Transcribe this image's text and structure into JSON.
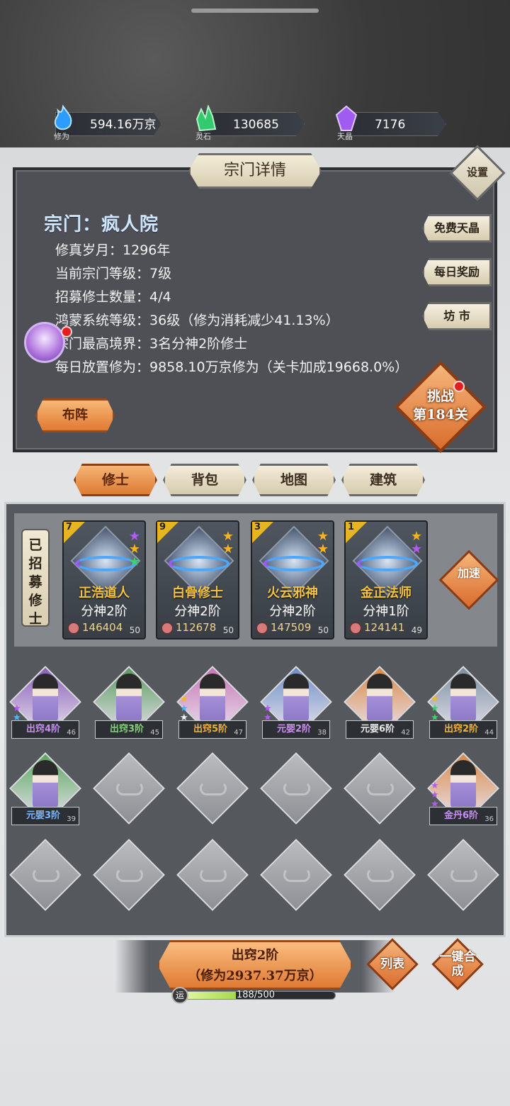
{
  "resources": [
    {
      "label": "修为",
      "value": "594.16万京",
      "color": "#2e9bff"
    },
    {
      "label": "灵石",
      "value": "130685",
      "color": "#34c96e"
    },
    {
      "label": "天晶",
      "value": "7176",
      "color": "#a05cf0"
    }
  ],
  "panel": {
    "title": "宗门详情",
    "settings": "设置",
    "sect_name": "宗门：疯人院",
    "info": [
      {
        "key": "修真岁月：",
        "value": "1296年"
      },
      {
        "key": "当前宗门等级：",
        "value": "7级"
      },
      {
        "key": "招募修士数量：",
        "value": "4/4"
      },
      {
        "key": "鸿蒙系统等级：",
        "value": "36级（修为消耗减少41.13%）"
      },
      {
        "key": "宗门最高境界：",
        "value": "3名分神2阶修士"
      },
      {
        "key": "每日放置修为：",
        "value": "9858.10万京修为（关卡加成19668.0%）"
      }
    ],
    "side_buttons": [
      "免费天晶",
      "每日奖励",
      "坊 市"
    ],
    "formation": "布阵",
    "challenge_line1": "挑战",
    "challenge_line2": "第184关"
  },
  "tabs": [
    "修士",
    "背包",
    "地图",
    "建筑"
  ],
  "recruit_label": "已招募修士",
  "speed_up": "加速",
  "recruited": [
    {
      "level": "7",
      "name": "正浩道人",
      "rank": "分神2阶",
      "power": "146404",
      "power_level": "50",
      "stars": [
        "purple",
        "gold",
        "green"
      ]
    },
    {
      "level": "9",
      "name": "白骨修士",
      "rank": "分神2阶",
      "power": "112678",
      "power_level": "50",
      "stars": [
        "gold",
        "gold"
      ]
    },
    {
      "level": "3",
      "name": "火云邪神",
      "rank": "分神2阶",
      "power": "147509",
      "power_level": "50",
      "stars": [
        "gold",
        "gold"
      ]
    },
    {
      "level": "1",
      "name": "金正法师",
      "rank": "分神1阶",
      "power": "124141",
      "power_level": "49",
      "stars": [
        "gold",
        "purple"
      ]
    }
  ],
  "disciples": [
    {
      "label": "出窍4阶",
      "level": "46",
      "bg": "#8a5fb8",
      "label_color": "#c98df2"
    },
    {
      "label": "出窍3阶",
      "level": "45",
      "bg": "#5a9a5e",
      "label_color": "#82d27a"
    },
    {
      "label": "出窍5阶",
      "level": "47",
      "bg": "#c776b6",
      "label_color": "#f0b23a"
    },
    {
      "label": "元婴2阶",
      "level": "38",
      "bg": "#6d8ec4",
      "label_color": "#c98df2"
    },
    {
      "label": "元婴6阶",
      "level": "42",
      "bg": "#d98b4a",
      "label_color": "#e6e6e6"
    },
    {
      "label": "出窍2阶",
      "level": "44",
      "bg": "#7a8fa0",
      "label_color": "#f0b23a"
    },
    {
      "label": "元婴3阶",
      "level": "39",
      "bg": "#5aa65e",
      "label_color": "#7ab6ff"
    },
    {
      "label": "金丹6阶",
      "level": "36",
      "bg": "#d98b4a",
      "label_color": "#c98df2"
    }
  ],
  "bottom": {
    "line1": "出窍2阶",
    "line2": "（修为2937.37万京）",
    "list": "列表",
    "merge": "一键合成",
    "luck_icon": "运",
    "luck": "188/500",
    "luck_ratio": 0.376
  }
}
